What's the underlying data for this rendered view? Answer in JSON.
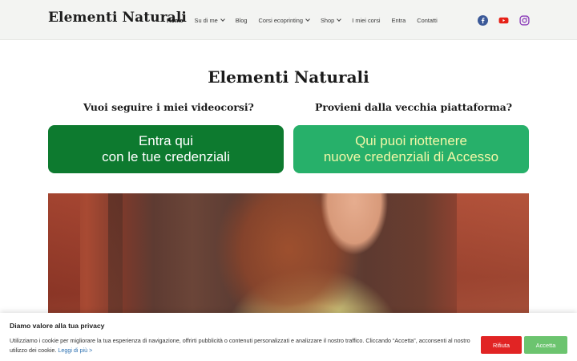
{
  "header": {
    "site_title": "Elementi Naturali",
    "nav": [
      {
        "label": "Home",
        "active": true,
        "dropdown": false
      },
      {
        "label": "Su di me",
        "active": false,
        "dropdown": true
      },
      {
        "label": "Blog",
        "active": false,
        "dropdown": false
      },
      {
        "label": "Corsi ecoprinting",
        "active": false,
        "dropdown": true
      },
      {
        "label": "Shop",
        "active": false,
        "dropdown": true
      },
      {
        "label": "I miei corsi",
        "active": false,
        "dropdown": false
      },
      {
        "label": "Entra",
        "active": false,
        "dropdown": false
      },
      {
        "label": "Contatti",
        "active": false,
        "dropdown": false
      }
    ],
    "social": [
      {
        "icon": "facebook-icon",
        "color": "#3b5998"
      },
      {
        "icon": "youtube-icon",
        "color": "#e62117"
      },
      {
        "icon": "instagram-icon",
        "color": "#8a3ab9"
      }
    ]
  },
  "main": {
    "title": "Elementi Naturali",
    "left_question": "Vuoi seguire i miei videocorsi?",
    "right_question": "Provieni dalla vecchia piattaforma?",
    "left_cta": {
      "line1": "Entra qui",
      "line2": "con le tue credenziali",
      "bg": "#0d7a2f",
      "text_color": "#ffffff"
    },
    "right_cta": {
      "line1": "Qui puoi riottenere",
      "line2": "nuove credenziali di Accesso",
      "bg": "#27b06a",
      "text_color": "#f3f7a8"
    }
  },
  "cookie": {
    "title": "Diamo valore alla tua privacy",
    "text": "Utilizziamo i cookie per migliorare la tua esperienza di navigazione, offrirti pubblicità o contenuti personalizzati e analizzare il nostro traffico. Cliccando “Accetta”, acconsenti al nostro utilizzo dei cookie.",
    "link": "Leggi di più >",
    "refuse_label": "Rifiuta",
    "accept_label": "Accetta"
  }
}
